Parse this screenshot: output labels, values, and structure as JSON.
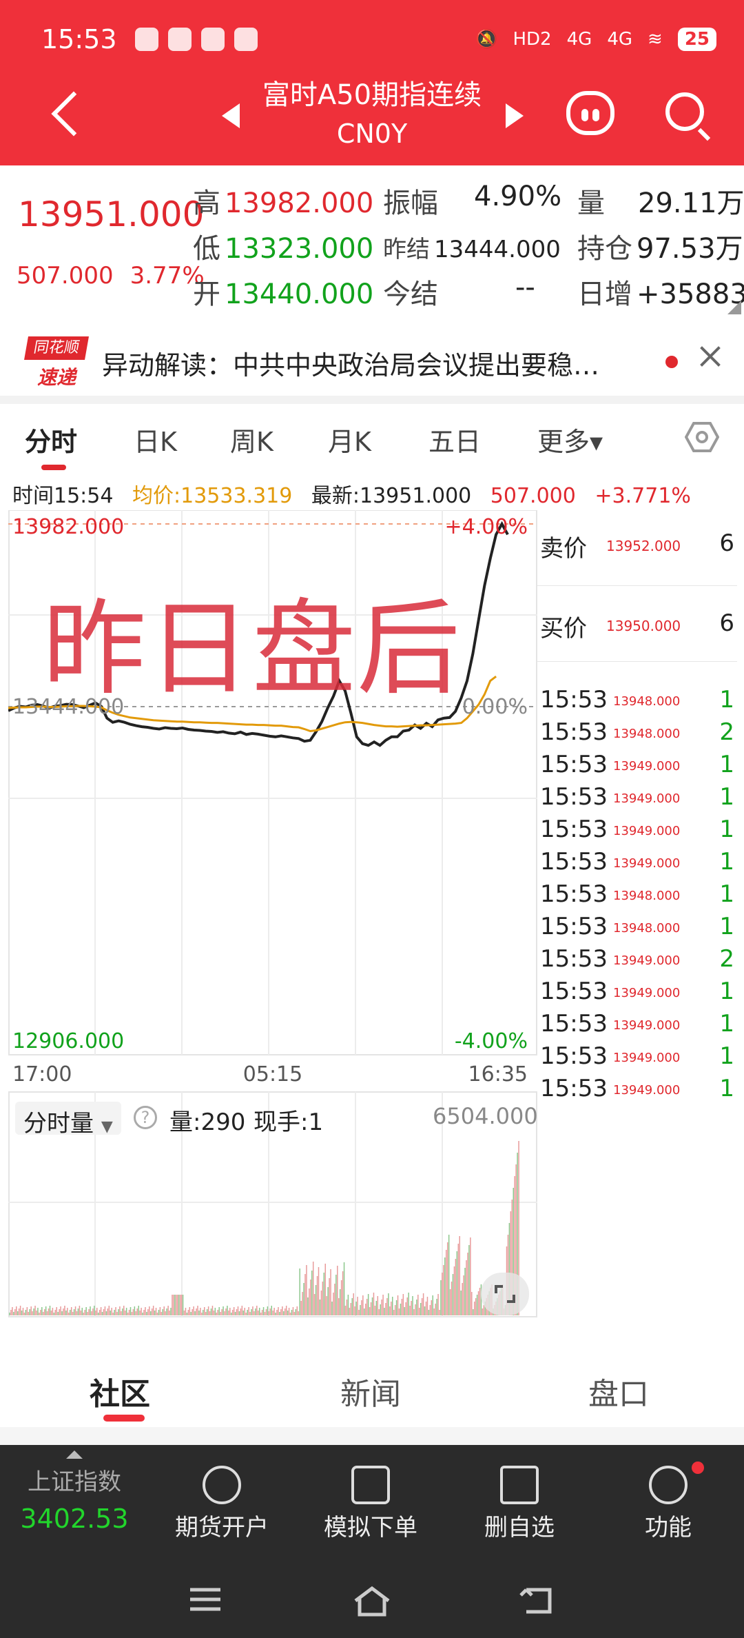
{
  "status": {
    "time": "15:53",
    "battery": "25",
    "signal": [
      "HD2",
      "4G",
      "4G"
    ]
  },
  "header": {
    "title": "富时A50期指连续",
    "code": "CN0Y"
  },
  "quote": {
    "price": "13951.000",
    "change": "507.000",
    "change_pct": "3.77%",
    "high_label": "高",
    "high": "13982.000",
    "low_label": "低",
    "low": "13323.000",
    "open_label": "开",
    "open": "13440.000",
    "amp_label": "振幅",
    "amp": "4.90%",
    "prev_label": "昨结",
    "prev": "13444.000",
    "today_label": "今结",
    "today": "--",
    "vol_label": "量",
    "vol": "29.11万",
    "oi_label": "持仓",
    "oi": "97.53万",
    "daily_label": "日增",
    "daily": "+35883"
  },
  "news": {
    "logo_top": "同花顺",
    "logo_bottom": "速递",
    "text": "异动解读：中共中央政治局会议提出要稳…"
  },
  "tabs": [
    "分时",
    "日K",
    "周K",
    "月K",
    "五日",
    "更多▾"
  ],
  "info": {
    "time": "时间15:54",
    "avg": "均价:13533.319",
    "latest": "最新:13951.000",
    "chg": "507.000",
    "pct": "+3.771%"
  },
  "chart_data": {
    "type": "line",
    "title": "",
    "xlabel": "",
    "ylabel": "",
    "x_ticks": [
      "17:00",
      "05:15",
      "16:35"
    ],
    "y_labels": {
      "top": "13982.000",
      "top_pct": "+4.00%",
      "mid": "13444.000",
      "mid_pct": "0.00%",
      "bottom": "12906.000",
      "bottom_pct": "-4.00%"
    },
    "ylim": [
      12906,
      13982
    ],
    "series": [
      {
        "values": [
          13432,
          13440,
          13445,
          13443,
          13448,
          13450,
          13446,
          13440,
          13445,
          13447,
          13451,
          13450,
          13446,
          13441,
          13448,
          13455,
          13445,
          13410,
          13398,
          13402,
          13398,
          13392,
          13388,
          13385,
          13383,
          13380,
          13378,
          13382,
          13380,
          13379,
          13381,
          13377,
          13375,
          13374,
          13372,
          13371,
          13368,
          13370,
          13366,
          13364,
          13369,
          13362,
          13365,
          13363,
          13360,
          13357,
          13355,
          13358,
          13355,
          13352,
          13350,
          13342,
          13345,
          13370,
          13400,
          13440,
          13475,
          13520,
          13490,
          13425,
          13355,
          13335,
          13330,
          13340,
          13330,
          13345,
          13355,
          13355,
          13372,
          13375,
          13390,
          13380,
          13395,
          13385,
          13405,
          13410,
          13412,
          13430,
          13470,
          13520,
          13600,
          13700,
          13800,
          13880,
          13951,
          13982,
          13951
        ]
      },
      {
        "values": [
          13440,
          13441,
          13442,
          13442,
          13443,
          13444,
          13444,
          13443,
          13443,
          13444,
          13445,
          13445,
          13446,
          13446,
          13445,
          13444,
          13442,
          13433,
          13426,
          13420,
          13416,
          13412,
          13410,
          13408,
          13406,
          13404,
          13403,
          13402,
          13401,
          13400,
          13400,
          13399,
          13398,
          13398,
          13397,
          13396,
          13396,
          13395,
          13394,
          13393,
          13392,
          13391,
          13391,
          13390,
          13390,
          13389,
          13388,
          13388,
          13386,
          13384,
          13383,
          13378,
          13372,
          13374,
          13379,
          13384,
          13389,
          13394,
          13398,
          13399,
          13398,
          13396,
          13393,
          13390,
          13388,
          13386,
          13386,
          13385,
          13386,
          13387,
          13388,
          13389,
          13389,
          13390,
          13391,
          13392,
          13393,
          13394,
          13396,
          13410,
          13430,
          13450,
          13480,
          13520,
          13533
        ]
      }
    ],
    "volume": {
      "selector": "分时量",
      "vol": "量:290",
      "hand": "现手:1",
      "max": "6504.000"
    }
  },
  "book": {
    "asks": [
      {
        "label": "卖价",
        "price": "13952.000",
        "vol": "6"
      }
    ],
    "bids": [
      {
        "label": "买价",
        "price": "13950.000",
        "vol": "6"
      }
    ],
    "trades": [
      {
        "t": "15:53",
        "p": "13948.000",
        "v": "1"
      },
      {
        "t": "15:53",
        "p": "13948.000",
        "v": "2"
      },
      {
        "t": "15:53",
        "p": "13949.000",
        "v": "1"
      },
      {
        "t": "15:53",
        "p": "13949.000",
        "v": "1"
      },
      {
        "t": "15:53",
        "p": "13949.000",
        "v": "1"
      },
      {
        "t": "15:53",
        "p": "13949.000",
        "v": "1"
      },
      {
        "t": "15:53",
        "p": "13948.000",
        "v": "1"
      },
      {
        "t": "15:53",
        "p": "13948.000",
        "v": "1"
      },
      {
        "t": "15:53",
        "p": "13949.000",
        "v": "2"
      },
      {
        "t": "15:53",
        "p": "13949.000",
        "v": "1"
      },
      {
        "t": "15:53",
        "p": "13949.000",
        "v": "1"
      },
      {
        "t": "15:53",
        "p": "13949.000",
        "v": "1"
      },
      {
        "t": "15:53",
        "p": "13949.000",
        "v": "1"
      }
    ]
  },
  "watermark": "昨日盘后",
  "bottom_tabs": [
    "社区",
    "新闻",
    "盘口"
  ],
  "toolbar": {
    "index_name": "上证指数",
    "index_value": "3402.53",
    "items": [
      "期货开户",
      "模拟下单",
      "删自选",
      "功能"
    ]
  }
}
